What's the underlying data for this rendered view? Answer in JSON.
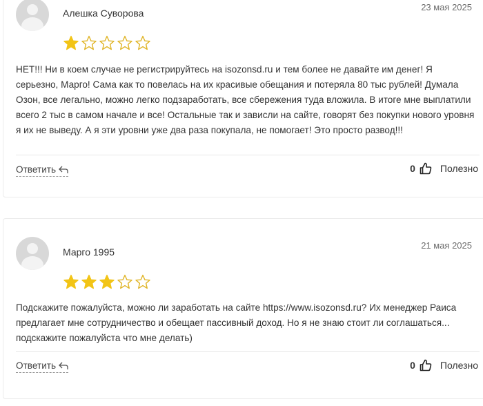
{
  "reviews": [
    {
      "author": "Алешка Суворова",
      "date": "23 мая 2025",
      "rating": 1,
      "max_rating": 5,
      "text": "НЕТ!!! Ни в коем случае не регистрируйтесь на isozonsd.ru и тем более не давайте им денег! Я серьезно, Марго! Сама как то повелась на их красивые обещания и потеряла 80 тыс рублей! Думала Озон, все легально, можно легко подзаработать, все сбережения туда вложила. В итоге мне выплатили всего 2 тыс в самом начале и все! Остальные так и зависли на сайте, говорят без покупки нового уровня я их не выведу. А я эти уровни уже два раза покупала, не помогает! Это просто развод!!!",
      "reply_label": "Ответить",
      "likes": "0",
      "useful_label": "Полезно"
    },
    {
      "author": "Марго 1995",
      "date": "21 мая 2025",
      "rating": 3,
      "max_rating": 5,
      "text": "Подскажите пожалуйста, можно ли заработать на сайте https://www.isozonsd.ru? Их менеджер Раиса предлагает мне сотрудничество и обещает пассивный доход. Но я не знаю стоит ли соглашаться... подскажите пожалуйста что мне делать)",
      "reply_label": "Ответить",
      "likes": "0",
      "useful_label": "Полезно"
    }
  ],
  "colors": {
    "star_filled": "#f2c416",
    "star_empty_stroke": "#e0b528",
    "avatar_bg": "#d8d8d8"
  },
  "icons": {
    "reply": "reply-arrow-icon",
    "like": "thumbs-up-icon",
    "avatar": "default-avatar-icon"
  }
}
